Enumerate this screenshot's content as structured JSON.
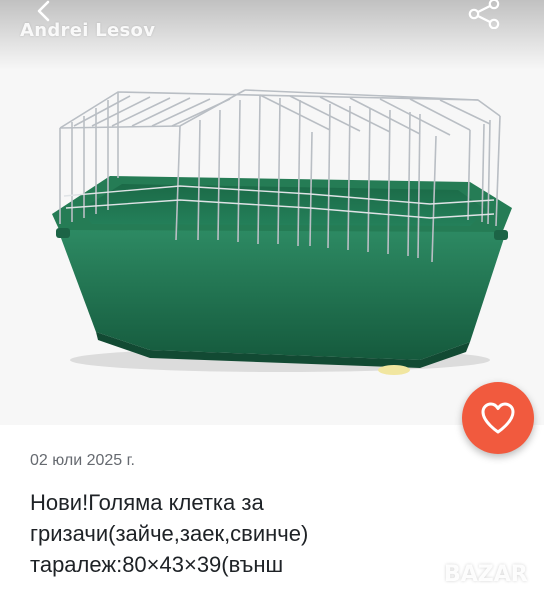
{
  "header": {
    "seller_name": "Andrei Lesov",
    "back_icon": "chevron-left-icon",
    "share_icon": "share-icon"
  },
  "listing": {
    "photo_subject": "cage",
    "favorite_icon": "heart-outline-icon",
    "date": "02 юли 2025 г.",
    "title_lines": [
      "Нови!Голяма клетка за",
      "гризачи(зайче,заек,свинче)",
      "таралеж:80×43×39(външ"
    ]
  },
  "watermark": {
    "text": "BAZAR"
  },
  "colors": {
    "favorite_button": "#f15a3e",
    "cage_base": "#1e6f4e",
    "text_primary": "#1e2226",
    "text_secondary": "#666a70"
  }
}
